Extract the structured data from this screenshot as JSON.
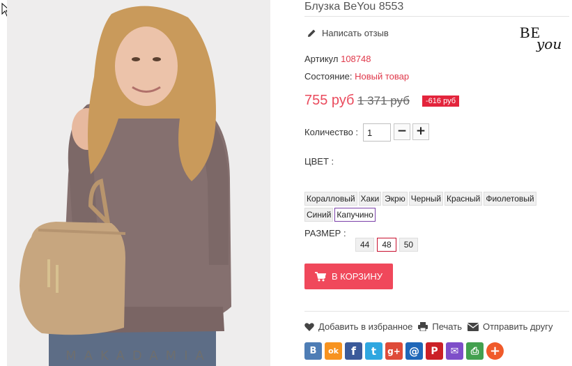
{
  "product": {
    "title": "Блузка BeYou 8553",
    "write_review": "Написать отзыв",
    "brand_logo_text": "BEyou",
    "sku_label": "Артикул",
    "sku_value": "108748",
    "condition_label": "Состояние:",
    "condition_value": "Новый товар",
    "price": "755 руб",
    "old_price": "1 371 руб",
    "discount": "-616 руб",
    "photo_watermark": "MAKADAMIA"
  },
  "quantity": {
    "label": "Количество :",
    "value": "1",
    "minus": "−",
    "plus": "+"
  },
  "color": {
    "label": "ЦВЕТ :",
    "options": [
      "Коралловый",
      "Хаки",
      "Экрю",
      "Черный",
      "Красный",
      "Фиолетовый",
      "Синий",
      "Капучино"
    ],
    "selected": "Капучино"
  },
  "size": {
    "label": "РАЗМЕР :",
    "options": [
      "44",
      "48",
      "50"
    ],
    "selected": "48"
  },
  "cart_button": "В КОРЗИНУ",
  "actions": {
    "wishlist": "Добавить в избранное",
    "print": "Печать",
    "send_friend": "Отправить другу"
  },
  "share": [
    {
      "name": "vkontakte",
      "glyph": "В",
      "color": "#4e7db5"
    },
    {
      "name": "odnoklassniki",
      "glyph": "ok",
      "color": "#f79320"
    },
    {
      "name": "facebook",
      "glyph": "f",
      "color": "#3b5a9a"
    },
    {
      "name": "twitter",
      "glyph": "t",
      "color": "#2fa7e0"
    },
    {
      "name": "google-plus",
      "glyph": "g+",
      "color": "#de4b39"
    },
    {
      "name": "mail-ru",
      "glyph": "@",
      "color": "#1f67b8"
    },
    {
      "name": "pinterest",
      "glyph": "P",
      "color": "#cb2027"
    },
    {
      "name": "email",
      "glyph": "✉",
      "color": "#7e4ec9"
    },
    {
      "name": "print",
      "glyph": "⎙",
      "color": "#43a04f"
    },
    {
      "name": "more",
      "glyph": "+",
      "color": "#f05a2a"
    }
  ],
  "colors": {
    "accent_red": "#e3243c",
    "price_red": "#ea4a5c"
  }
}
